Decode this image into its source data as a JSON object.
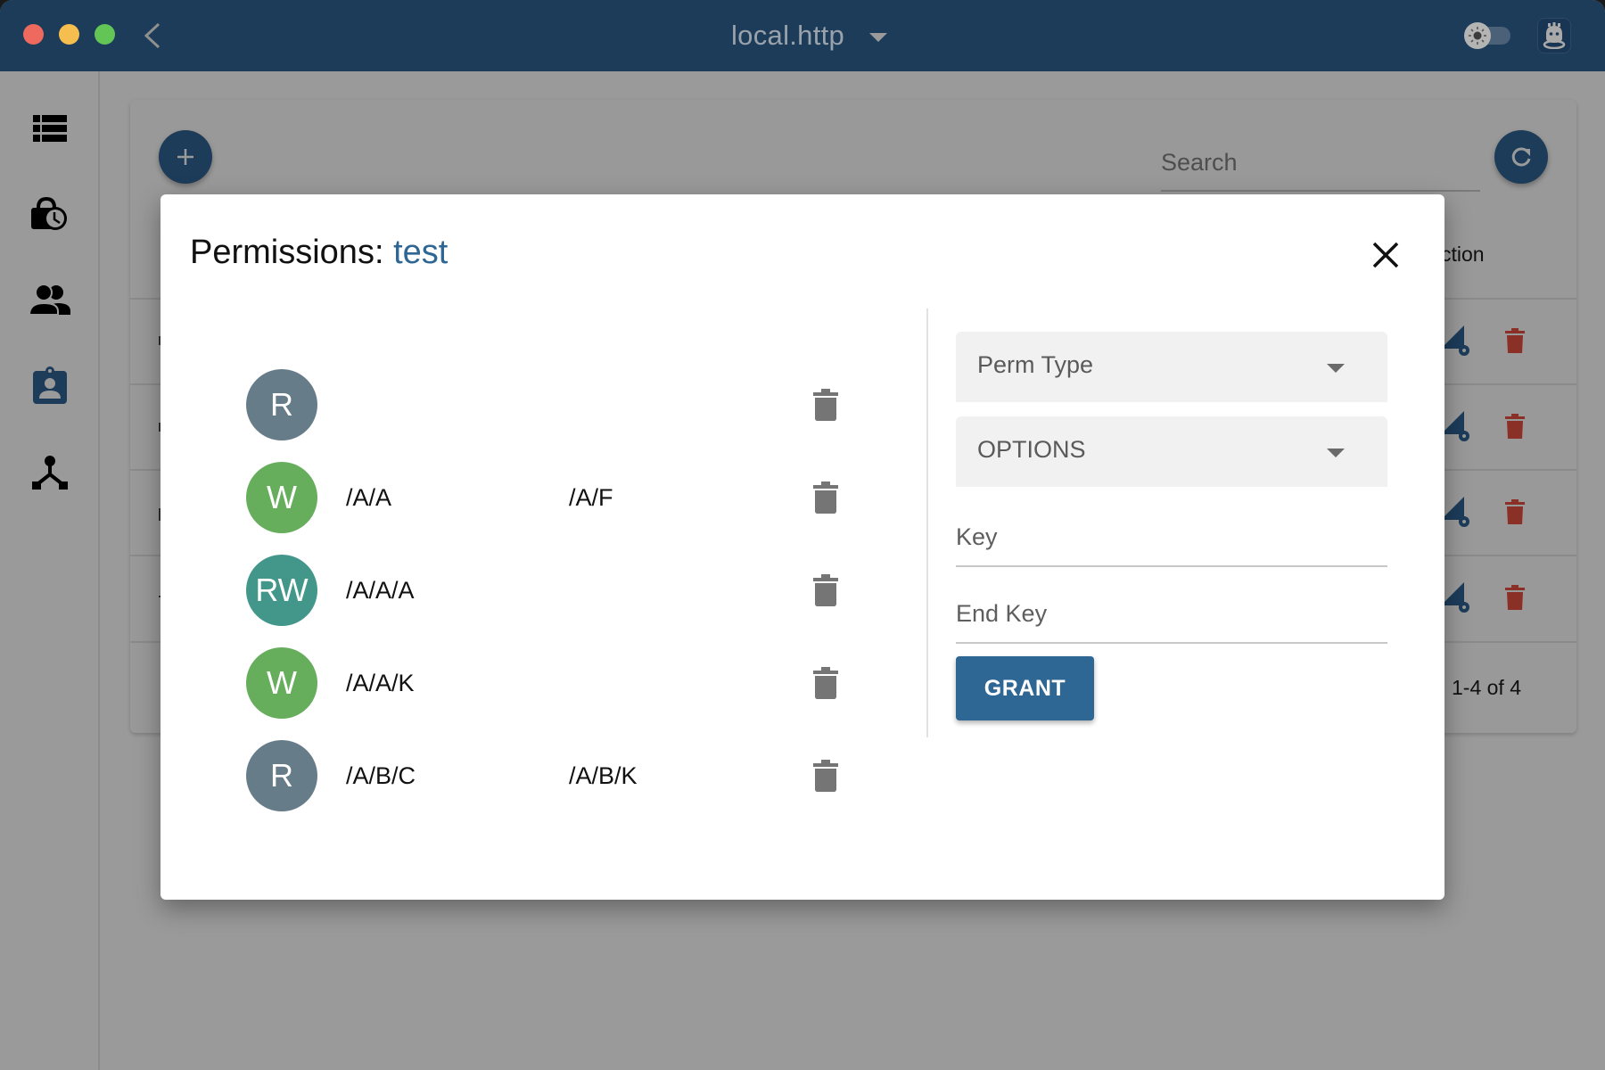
{
  "window": {
    "title": "local.http",
    "theme_toggle": {
      "icon": "sun-icon",
      "state": "light"
    },
    "account_icon": "robot-avatar-icon"
  },
  "sidebar": {
    "items": [
      {
        "name": "collections",
        "icon": "list-icon"
      },
      {
        "name": "leases",
        "icon": "lock-clock-icon"
      },
      {
        "name": "users",
        "icon": "people-icon"
      },
      {
        "name": "roles",
        "icon": "badge-icon",
        "active": true
      },
      {
        "name": "cluster",
        "icon": "network-icon"
      }
    ]
  },
  "card": {
    "search_placeholder": "Search",
    "action_column_header": "ction",
    "row_count": 4,
    "pager": "1-4 of 4"
  },
  "modal": {
    "title_prefix": "Permissions: ",
    "role_name": "test",
    "permissions": [
      {
        "type": "R",
        "key": "",
        "end_key": "",
        "color": "#667c89"
      },
      {
        "type": "W",
        "key": "/A/A",
        "end_key": "/A/F",
        "color": "#66ad5c"
      },
      {
        "type": "RW",
        "key": "/A/A/A",
        "end_key": "",
        "color": "#42968a"
      },
      {
        "type": "W",
        "key": "/A/A/K",
        "end_key": "",
        "color": "#66ad5c"
      },
      {
        "type": "R",
        "key": "/A/B/C",
        "end_key": "/A/B/K",
        "color": "#667c89"
      }
    ],
    "form": {
      "perm_type_label": "Perm Type",
      "options_label": "OPTIONS",
      "key_placeholder": "Key",
      "end_key_placeholder": "End Key",
      "grant_label": "GRANT"
    }
  },
  "colors": {
    "titlebar": "#1c3c5a",
    "accent": "#2e6694",
    "danger": "#8b3027"
  }
}
